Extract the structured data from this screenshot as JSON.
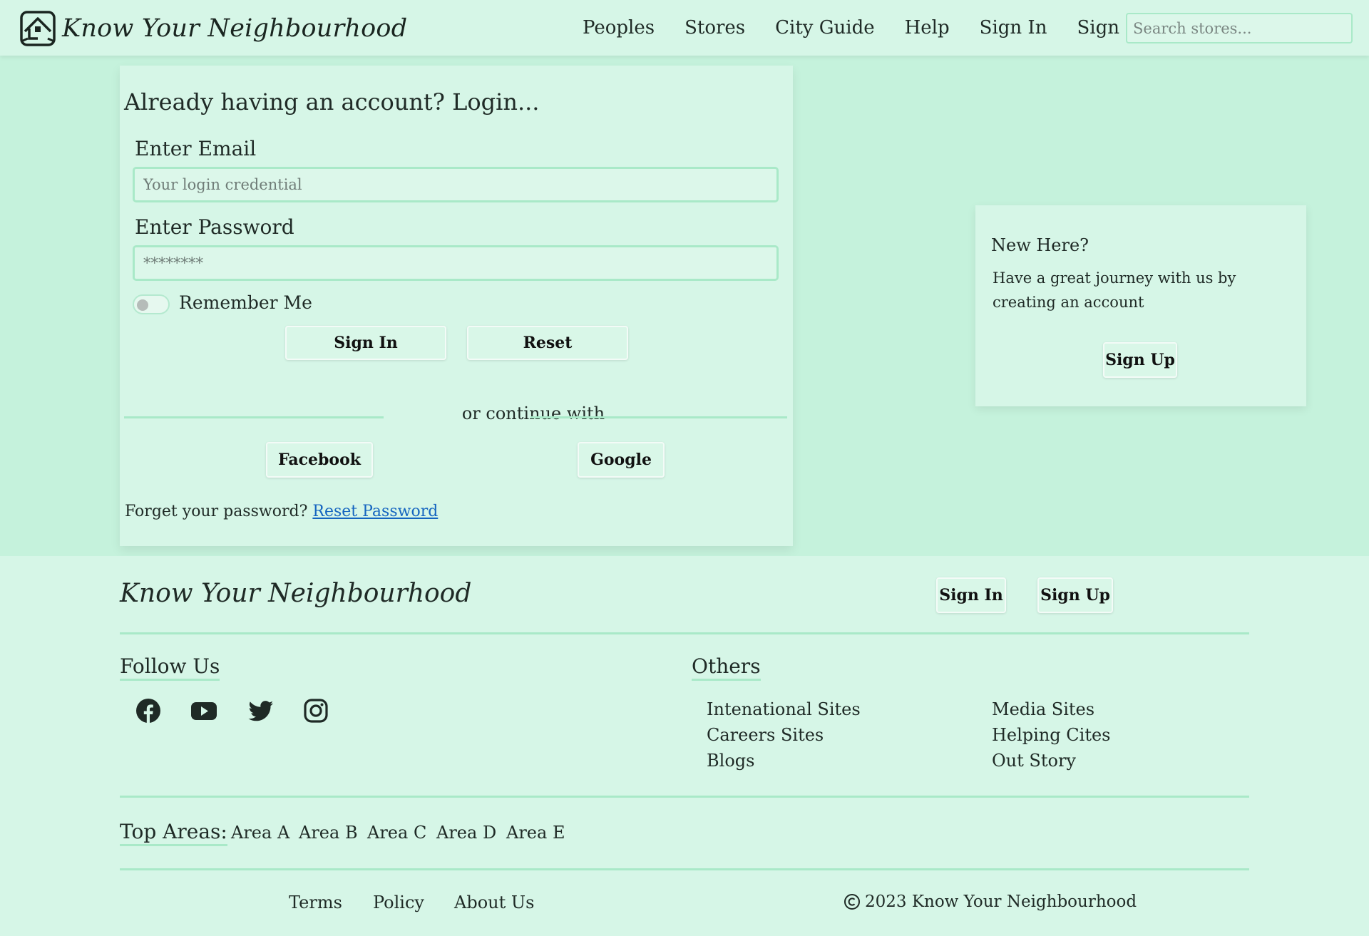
{
  "brand": {
    "name": "Know Your Neighbourhood"
  },
  "nav": {
    "links": [
      "Peoples",
      "Stores",
      "City Guide",
      "Help",
      "Sign In",
      "Sign Up"
    ],
    "search_placeholder": "Search stores..."
  },
  "login": {
    "title": "Already having an account? Login...",
    "email_label": "Enter Email",
    "email_placeholder": "Your login credential",
    "password_label": "Enter Password",
    "password_placeholder": "********",
    "remember_label": "Remember Me",
    "signin_button": "Sign In",
    "reset_button": "Reset",
    "divider_text": "or continue with",
    "facebook_button": "Facebook",
    "google_button": "Google",
    "forgot_text": "Forget your password?",
    "reset_link": "Reset Password"
  },
  "new_here": {
    "title": "New Here?",
    "text": "Have a great journey with us by creating an account",
    "button": "Sign Up"
  },
  "footer": {
    "brand": "Know Your Neighbourhood",
    "signin_button": "Sign In",
    "signup_button": "Sign Up",
    "follow_title": "Follow Us",
    "social_icons": [
      "facebook-icon",
      "youtube-icon",
      "twitter-icon",
      "instagram-icon"
    ],
    "others_title": "Others",
    "others_left": [
      "Intenational Sites",
      "Careers Sites",
      "Blogs"
    ],
    "others_right": [
      "Media Sites",
      "Helping Cites",
      "Out Story"
    ],
    "areas_title": "Top Areas:",
    "areas": [
      "Area A",
      "Area B",
      "Area C",
      "Area D",
      "Area E"
    ],
    "bottom_links": [
      "Terms",
      "Policy",
      "About Us"
    ],
    "copyright": "2023 Know Your Neighbourhood"
  },
  "colors": {
    "background": "#c5f2dc",
    "panel": "#d6f6e7",
    "accent_line": "#a9e9c8",
    "link": "#1565c0"
  }
}
